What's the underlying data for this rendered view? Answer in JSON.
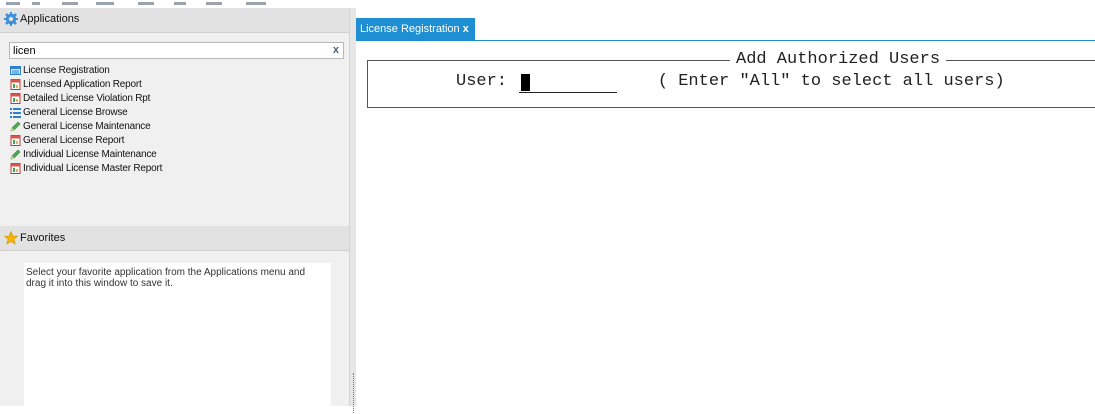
{
  "applications": {
    "title": "Applications",
    "search": {
      "value": "licen",
      "clear_label": "x"
    },
    "items": [
      {
        "label": "License Registration",
        "icon": "list-form-icon"
      },
      {
        "label": "Licensed Application Report",
        "icon": "report-icon"
      },
      {
        "label": "Detailed License Violation Rpt",
        "icon": "report-icon"
      },
      {
        "label": "General License Browse",
        "icon": "browse-list-icon"
      },
      {
        "label": "General License Maintenance",
        "icon": "pencil-icon"
      },
      {
        "label": "General License Report",
        "icon": "report-icon"
      },
      {
        "label": "Individual License Maintenance",
        "icon": "pencil-icon"
      },
      {
        "label": "Individual License Master Report",
        "icon": "report-icon"
      }
    ]
  },
  "favorites": {
    "title": "Favorites",
    "hint": "Select your favorite application from the Applications menu and drag it into this window to save it."
  },
  "tab": {
    "label": "License Registration",
    "close_label": "x"
  },
  "terminal": {
    "title": "Add Authorized Users",
    "user_label": "User:",
    "user_value": "",
    "hint": "( Enter \"All\" to select all users)"
  },
  "colors": {
    "tab_accent": "#1e8fd2",
    "pane_background": "#f0f0f0"
  }
}
